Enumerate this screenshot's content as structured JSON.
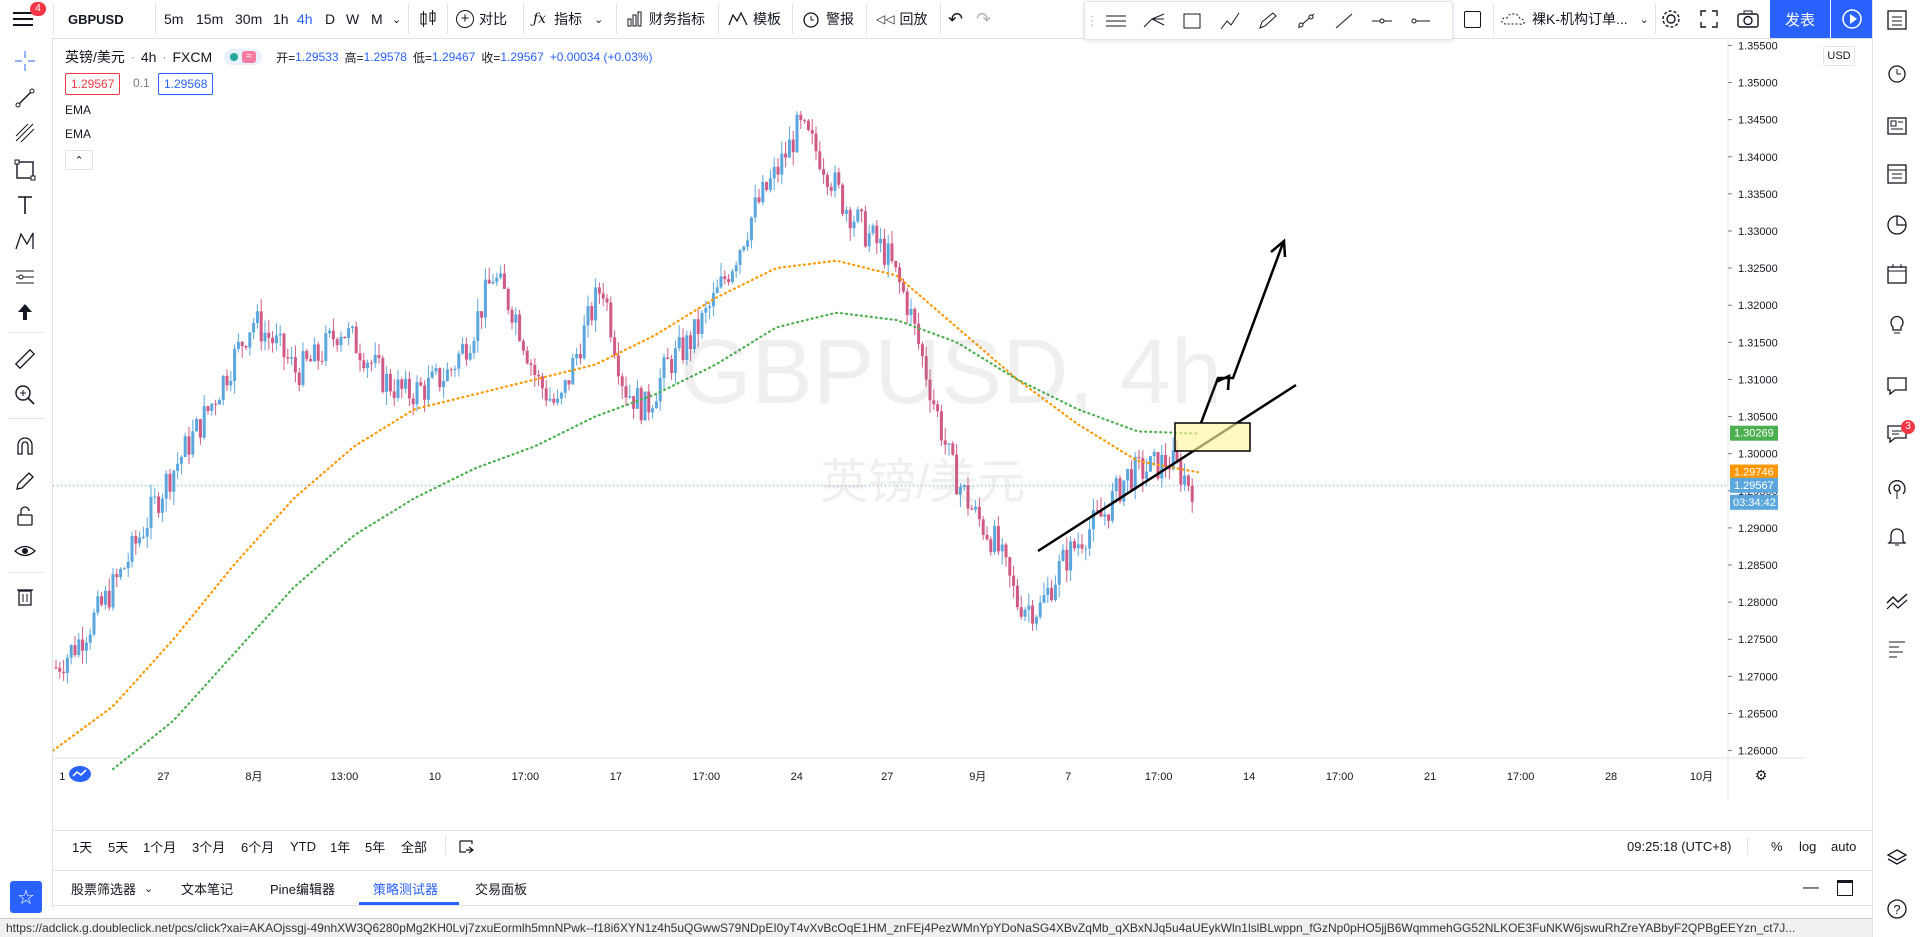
{
  "topbar": {
    "symbol": "GBPUSD",
    "intervals": [
      "5m",
      "15m",
      "30m",
      "1h",
      "4h",
      "D",
      "W",
      "M"
    ],
    "selected_interval": "4h",
    "compare": "对比",
    "indicators": "指标",
    "financials": "财务指标",
    "templates": "模板",
    "alert": "警报",
    "replay": "回放",
    "template_name": "裸K-机构订单...",
    "publish": "发表",
    "notifications": "4"
  },
  "legend": {
    "symbol_name": "英镑/美元",
    "interval": "4h",
    "exchange": "FXCM",
    "open_label": "开=",
    "open": "1.29533",
    "high_label": "高=",
    "high": "1.29578",
    "low_label": "低=",
    "low": "1.29467",
    "close_label": "收=",
    "close": "1.29567",
    "change": "+0.00034 (+0.03%)",
    "sell_price": "1.29567",
    "spread": "0.1",
    "buy_price": "1.29568",
    "indicator_1": "EMA",
    "indicator_2": "EMA"
  },
  "watermark": {
    "symbol": "GBPUSD, 4h",
    "name": "英镑/美元"
  },
  "price_axis": {
    "currency": "USD",
    "labels": [
      "1.35500",
      "1.35000",
      "1.34500",
      "1.34000",
      "1.33500",
      "1.33000",
      "1.32500",
      "1.32000",
      "1.31500",
      "1.31000",
      "1.30500",
      "1.30000",
      "1.29500",
      "1.29000",
      "1.28500",
      "1.28000",
      "1.27500",
      "1.27000",
      "1.26500",
      "1.26000"
    ],
    "badge_ema_long": "1.30269",
    "badge_ema_short": "1.29746",
    "badge_last": "1.29567",
    "badge_countdown": "03:34:42"
  },
  "time_axis": {
    "labels": [
      "17:00",
      "27",
      "8月",
      "13:00",
      "10",
      "17:00",
      "17",
      "17:00",
      "24",
      "27",
      "9月",
      "7",
      "17:00",
      "14",
      "17:00",
      "21",
      "17:00",
      "28",
      "10月"
    ]
  },
  "colors": {
    "up": "#5ba7dd",
    "down": "#d05a85",
    "ema_short": "#ff9800",
    "ema_long": "#4caf50",
    "accent": "#2962ff"
  },
  "ranges": {
    "items": [
      "1天",
      "5天",
      "1个月",
      "3个月",
      "6个月",
      "YTD",
      "1年",
      "5年",
      "全部"
    ]
  },
  "bottom_right": {
    "time": "09:25:18 (UTC+8)",
    "percent": "%",
    "log": "log",
    "auto": "auto"
  },
  "panels": {
    "items": [
      "股票筛选器",
      "文本笔记",
      "Pine编辑器",
      "策略测试器",
      "交易面板"
    ],
    "active": "策略测试器"
  },
  "status_url": "https://adclick.g.doubleclick.net/pcs/click?xai=AKAOjssgj-49nhXW3Q6280pMg2KH0Lvj7zxuEormlh5mnNPwk--f18i6XYN1z4h5uQGwwS79NDpEI0yT4vXvBcOqE1HM_znFEj4PezWMnYpYDoNaSG4XBvZqMb_qXBxNJq5u4aUEykWln1lslBLwppn_fGzNp0pHO5jjB6WqmmehGG52NLKOE3FuNKW6jswuRhZreYABbyF2QPBgEEYzn_ct7J...",
  "chart_data": {
    "type": "candlestick",
    "series": [
      {
        "name": "GBPUSD 4h",
        "approx_close": [
          1.2712,
          1.2745,
          1.279,
          1.284,
          1.29,
          1.296,
          1.301,
          1.306,
          1.312,
          1.318,
          1.315,
          1.311,
          1.313,
          1.317,
          1.314,
          1.31,
          1.308,
          1.309,
          1.311,
          1.316,
          1.324,
          1.319,
          1.31,
          1.306,
          1.315,
          1.323,
          1.309,
          1.306,
          1.312,
          1.315,
          1.32,
          1.326,
          1.333,
          1.338,
          1.344,
          1.34,
          1.334,
          1.33,
          1.327,
          1.32,
          1.309,
          1.298,
          1.292,
          1.288,
          1.28,
          1.279,
          1.285,
          1.289,
          1.292,
          1.297,
          1.298,
          1.299,
          1.2957
        ]
      },
      {
        "name": "EMA",
        "approx": [
          1.26,
          1.266,
          1.275,
          1.285,
          1.294,
          1.301,
          1.306,
          1.308,
          1.31,
          1.312,
          1.316,
          1.321,
          1.325,
          1.326,
          1.324,
          1.317,
          1.31,
          1.304,
          1.299,
          1.2975
        ]
      },
      {
        "name": "EMA",
        "approx": [
          1.2575,
          1.264,
          1.273,
          1.282,
          1.289,
          1.294,
          1.298,
          1.301,
          1.305,
          1.308,
          1.312,
          1.317,
          1.319,
          1.318,
          1.315,
          1.31,
          1.306,
          1.303,
          1.3027
        ]
      }
    ],
    "y_range": [
      1.259,
      1.356
    ],
    "last_price": 1.29567,
    "annotations": [
      "trendline",
      "long arrow up",
      "highlight box"
    ]
  }
}
